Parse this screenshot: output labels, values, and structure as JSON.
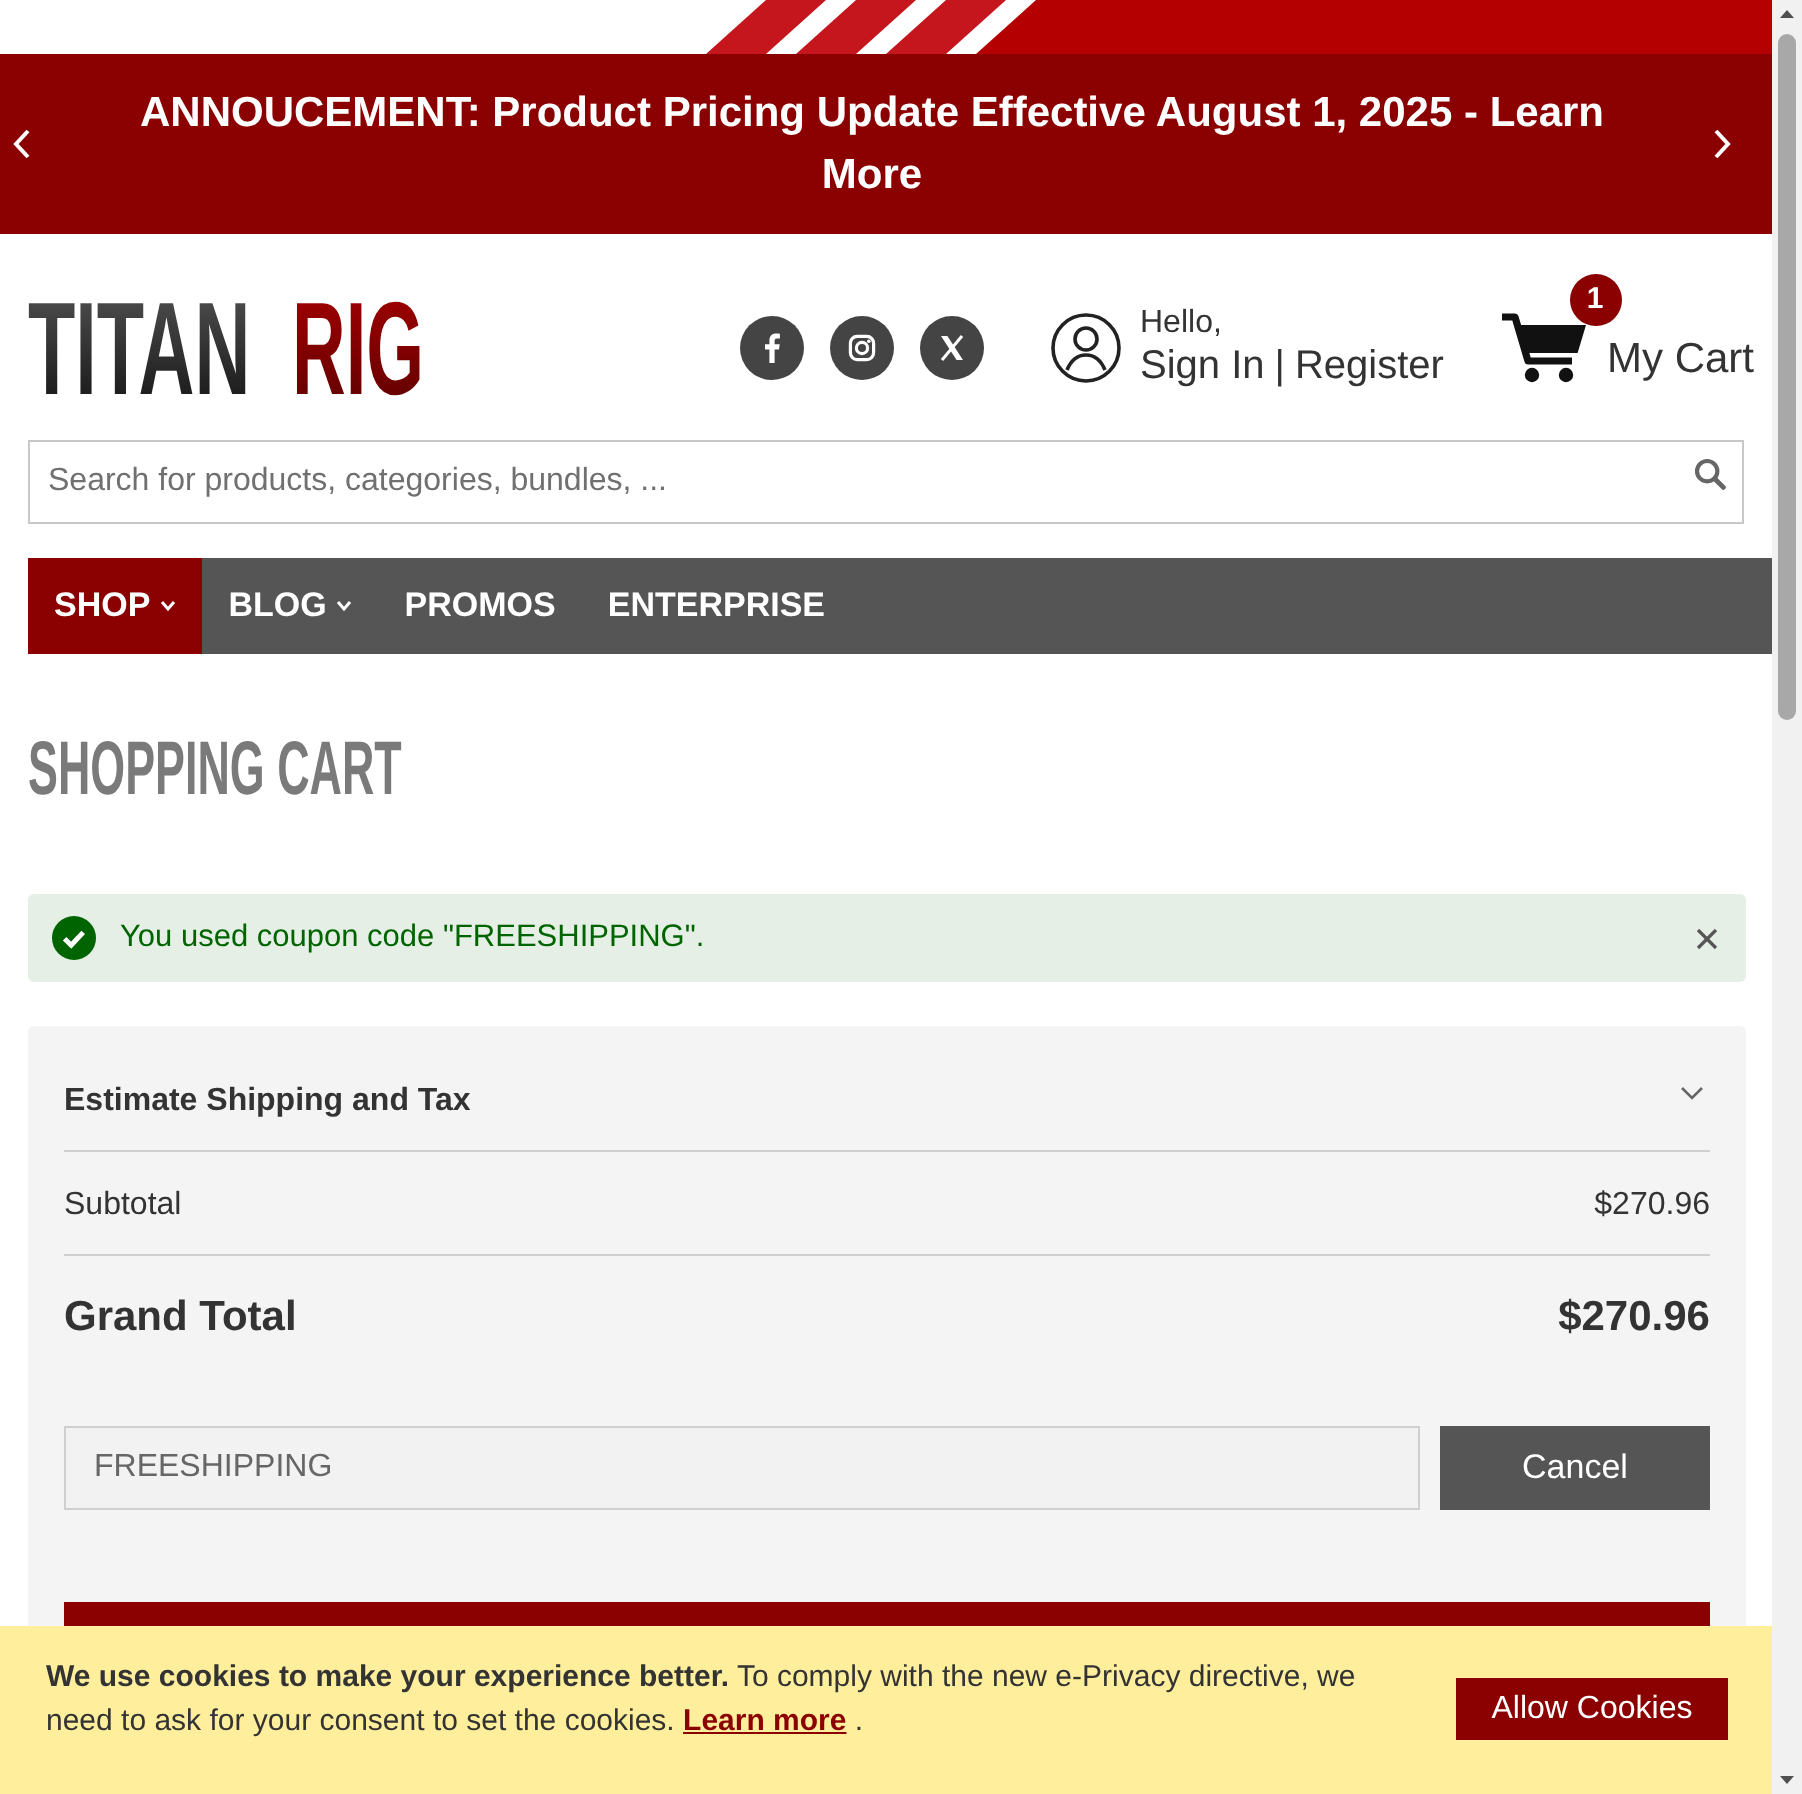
{
  "banner": {
    "text": "ANNOUCEMENT: Product Pricing Update Effective August 1, 2025 - Learn More"
  },
  "header": {
    "logo": {
      "first": "TITAN",
      "second": "RIG"
    },
    "account": {
      "greeting": "Hello,",
      "sign_in": "Sign In",
      "separator": "|",
      "register": "Register"
    },
    "cart": {
      "count": "1",
      "label": "My Cart"
    }
  },
  "search": {
    "placeholder": "Search for products, categories, bundles, ..."
  },
  "nav": [
    {
      "label": "SHOP",
      "dropdown": true,
      "selected": true
    },
    {
      "label": "BLOG",
      "dropdown": true,
      "selected": false
    },
    {
      "label": "PROMOS",
      "dropdown": false,
      "selected": false
    },
    {
      "label": "ENTERPRISE",
      "dropdown": false,
      "selected": false
    }
  ],
  "page_title": "SHOPPING CART",
  "alert": {
    "message": "You used coupon code \"FREESHIPPING\"."
  },
  "summary": {
    "estimate": {
      "label": "Estimate Shipping and Tax",
      "expanded": false
    },
    "subtotal": {
      "label": "Subtotal",
      "value": "$270.96"
    },
    "grand_total": {
      "label": "Grand Total",
      "value": "$270.96"
    },
    "coupon": {
      "value": "FREESHIPPING",
      "button": "Cancel"
    }
  },
  "cookie_notice": {
    "text": "**We use cookies to make your experience better.** To comply with the new e-Privacy directive, we need to ask for your consent to set the cookies.",
    "link": "Learn more",
    "after": ".",
    "button": "Allow Cookies"
  }
}
